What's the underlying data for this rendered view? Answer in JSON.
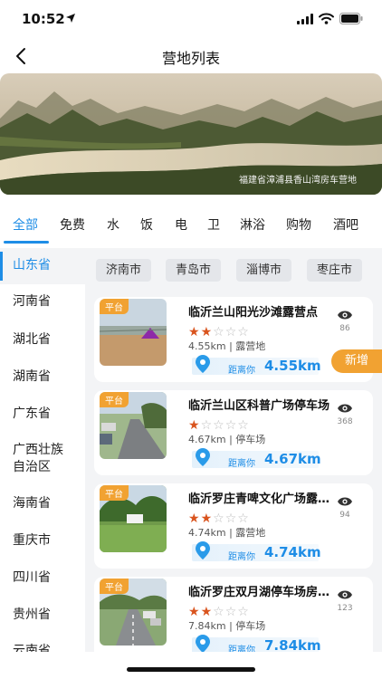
{
  "status_bar": {
    "time": "10:52"
  },
  "nav": {
    "title": "营地列表"
  },
  "banner": {
    "caption": "福建省漳浦县香山湾房车营地"
  },
  "categories": [
    "全部",
    "免费",
    "水",
    "饭",
    "电",
    "卫",
    "淋浴",
    "购物",
    "酒吧"
  ],
  "provinces": [
    "山东省",
    "河南省",
    "湖北省",
    "湖南省",
    "广东省",
    "广西壮族自治区",
    "海南省",
    "重庆市",
    "四川省",
    "贵州省",
    "云南省"
  ],
  "cities": [
    "济南市",
    "青岛市",
    "淄博市",
    "枣庄市"
  ],
  "camps": [
    {
      "tag": "平台",
      "name": "临沂兰山阳光沙滩露营点",
      "rating": 2,
      "max_rating": 5,
      "distance": "4.55km",
      "type": "露营地",
      "meta": "4.55km | 露营地",
      "distance_label": "距离你",
      "views": "86"
    },
    {
      "tag": "平台",
      "name": "临沂兰山区科普广场停车场",
      "rating": 1,
      "max_rating": 5,
      "distance": "4.67km",
      "type": "停车场",
      "meta": "4.67km | 停车场",
      "distance_label": "距离你",
      "views": "368"
    },
    {
      "tag": "平台",
      "name": "临沂罗庄青啤文化广场露营地",
      "rating": 2,
      "max_rating": 5,
      "distance": "4.74km",
      "type": "露营地",
      "meta": "4.74km | 露营地",
      "distance_label": "距离你",
      "views": "94"
    },
    {
      "tag": "平台",
      "name": "临沂罗庄双月湖停车场房车营地",
      "rating": 2,
      "max_rating": 5,
      "distance": "7.84km",
      "type": "停车场",
      "meta": "7.84km | 停车场",
      "distance_label": "距离你",
      "views": "123"
    }
  ],
  "add_button": "新增",
  "colors": {
    "accent": "#1e8de6",
    "tag": "#f1a232",
    "star": "#d9541e"
  }
}
